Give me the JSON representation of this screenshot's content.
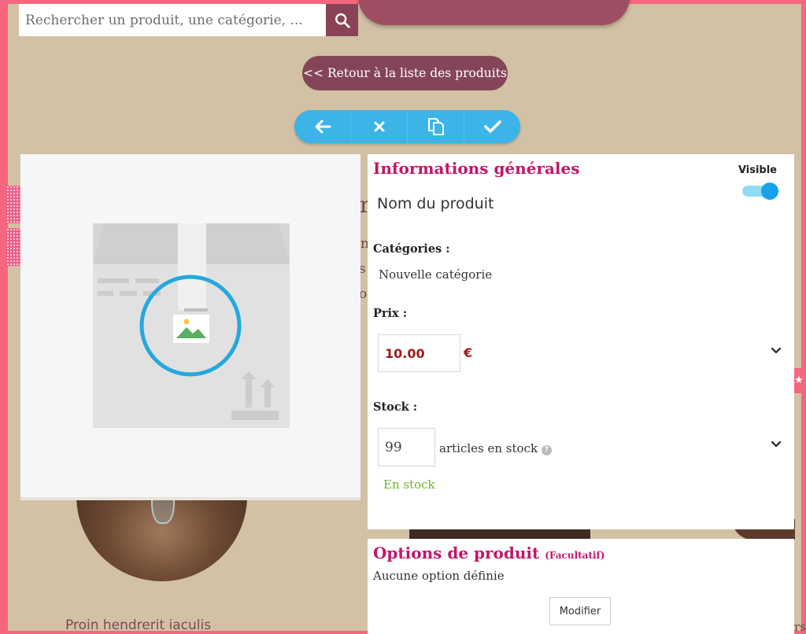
{
  "search": {
    "placeholder": "Rechercher un produit, une catégorie, ..."
  },
  "nav": {
    "back_label": "<< Retour à la liste des produits"
  },
  "toolbar": {
    "icons": [
      "arrow-left-icon",
      "close-icon",
      "copy-icon",
      "check-icon"
    ]
  },
  "background": {
    "caption": "Proin hendrerit iaculis",
    "fragments": [
      "re",
      "n",
      "s i",
      "on",
      "rs"
    ]
  },
  "general": {
    "title": "Informations générales",
    "visible_label": "Visible",
    "visible_on": true,
    "product_name": "Nom du produit",
    "categories_label": "Catégories :",
    "category_value": "Nouvelle catégorie",
    "price_label": "Prix :",
    "price_value": "10.00",
    "currency": "€",
    "stock_label": "Stock :",
    "stock_value": "99",
    "stock_suffix": "articles en stock",
    "help_glyph": "?",
    "stock_status": "En stock"
  },
  "options": {
    "title": "Options de produit",
    "subtitle": "(Facultatif)",
    "empty_text": "Aucune option définie",
    "modify_label": "Modifier"
  },
  "colors": {
    "frame": "#f5677f",
    "accent": "#c2166a",
    "toolbar": "#3cb4e8",
    "back_button": "#854558",
    "in_stock": "#6ab52e",
    "price": "#9b1b1b"
  }
}
